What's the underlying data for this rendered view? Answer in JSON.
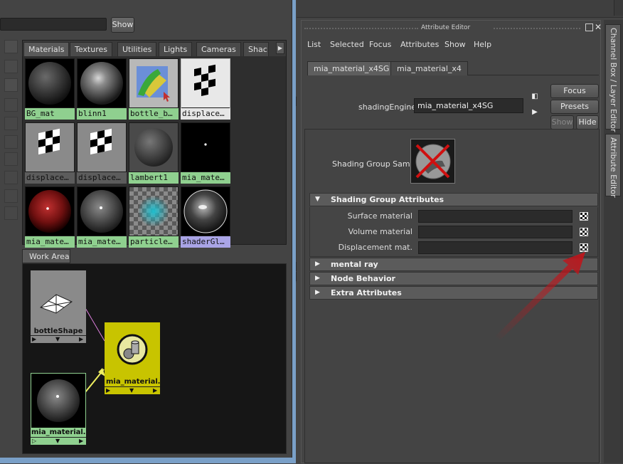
{
  "hypershade": {
    "show_label": "Show",
    "tabs": [
      "Materials",
      "Textures",
      "Utilities",
      "Lights",
      "Cameras",
      "Shac"
    ],
    "tab_scroll_icon": "triangle-right",
    "swatches": [
      {
        "label": "BG_mat"
      },
      {
        "label": "blinn1"
      },
      {
        "label": "bottle_b…"
      },
      {
        "label": "displace…"
      },
      {
        "label": "displace…"
      },
      {
        "label": "displace…"
      },
      {
        "label": "lambert1"
      },
      {
        "label": "mia_mate…"
      },
      {
        "label": "mia_mate…"
      },
      {
        "label": "mia_mate…"
      },
      {
        "label": "particle…"
      },
      {
        "label": "shaderGl…"
      }
    ],
    "work_area_tab": "Work Area",
    "nodes": {
      "bottle_shape": "bottleShape",
      "mia_material_sg": "mia_material…",
      "mia_material": "mia_material…"
    }
  },
  "attribute_editor": {
    "title": "Attribute Editor",
    "menu": [
      "List",
      "Selected",
      "Focus",
      "Attributes",
      "Show",
      "Help"
    ],
    "node_tabs": [
      "mia_material_x4SG",
      "mia_material_x4"
    ],
    "shading_engine_label": "shadingEngine:",
    "shading_engine_value": "mia_material_x4SG",
    "buttons": {
      "focus": "Focus",
      "presets": "Presets",
      "show": "Show",
      "hide": "Hide"
    },
    "sample_label": "Shading Group Sample",
    "sections": {
      "sga": "Shading Group Attributes",
      "mental_ray": "mental ray",
      "node_behavior": "Node Behavior",
      "extra": "Extra Attributes"
    },
    "attributes": [
      {
        "label": "Surface material"
      },
      {
        "label": "Volume material"
      },
      {
        "label": "Displacement mat."
      }
    ],
    "close_icon": "close-icon"
  },
  "dock": {
    "tabs": [
      "Channel Box / Layer Editor",
      "Attribute Editor"
    ]
  },
  "colors": {
    "caption_green": "#8fd08f",
    "caption_purple": "#a9a4e6",
    "node_yellow": "#c8c400",
    "arrow_red": "#c0141a"
  }
}
